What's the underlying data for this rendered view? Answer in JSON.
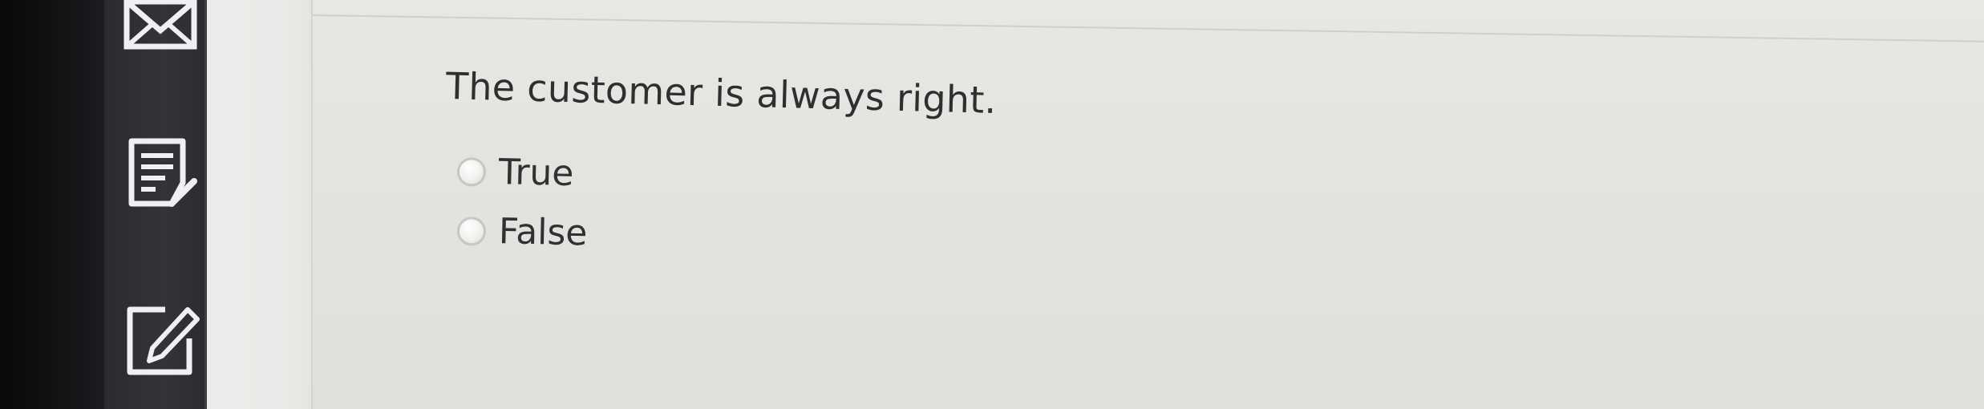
{
  "sidebar": {
    "tools": [
      {
        "icon": "mail-icon"
      },
      {
        "icon": "notes-icon"
      },
      {
        "icon": "edit-icon"
      }
    ]
  },
  "quiz": {
    "question": "The customer is always right.",
    "options": [
      {
        "label": "True",
        "selected": false
      },
      {
        "label": "False",
        "selected": false
      }
    ]
  }
}
